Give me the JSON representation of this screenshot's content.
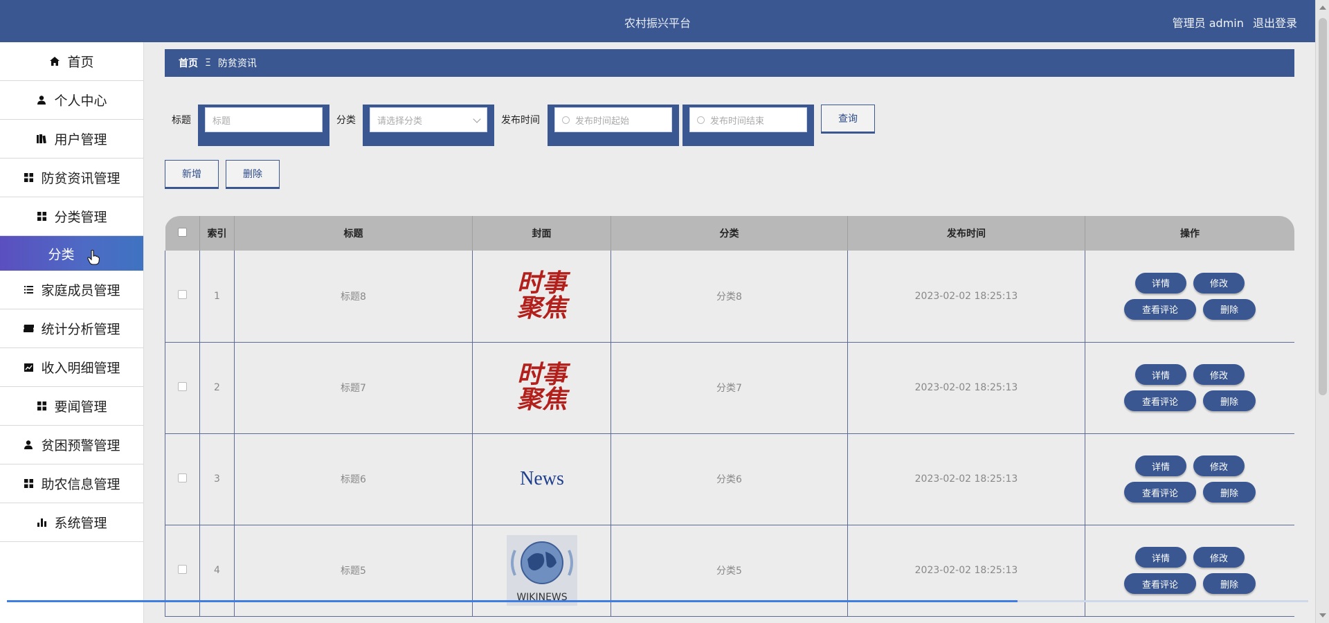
{
  "header": {
    "title": "农村振兴平台",
    "user": "管理员 admin",
    "logout": "退出登录"
  },
  "sidebar": {
    "items": [
      {
        "label": "首页",
        "icon": "home-icon"
      },
      {
        "label": "个人中心",
        "icon": "user-icon"
      },
      {
        "label": "用户管理",
        "icon": "book-icon"
      },
      {
        "label": "防贫资讯管理",
        "icon": "grid-icon"
      },
      {
        "label": "分类管理",
        "icon": "grid-icon"
      },
      {
        "label": "分类",
        "icon": "",
        "active": true
      },
      {
        "label": "家庭成员管理",
        "icon": "list-icon"
      },
      {
        "label": "统计分析管理",
        "icon": "ticket-icon"
      },
      {
        "label": "收入明细管理",
        "icon": "chart-icon"
      },
      {
        "label": "要闻管理",
        "icon": "grid-icon"
      },
      {
        "label": "贫困预警管理",
        "icon": "user-icon"
      },
      {
        "label": "助农信息管理",
        "icon": "grid-icon"
      },
      {
        "label": "系统管理",
        "icon": "bar-chart-icon"
      }
    ]
  },
  "breadcrumb": {
    "home": "首页",
    "separator": "Ξ",
    "current": "防贫资讯"
  },
  "filter": {
    "title_label": "标题",
    "title_placeholder": "标题",
    "category_label": "分类",
    "category_placeholder": "请选择分类",
    "time_label": "发布时间",
    "time_start_placeholder": "发布时间起始",
    "time_end_placeholder": "发布时间结束",
    "search_button": "查询"
  },
  "actions": {
    "add": "新增",
    "delete": "删除"
  },
  "table": {
    "headers": [
      "索引",
      "标题",
      "封面",
      "分类",
      "发布时间",
      "操作"
    ],
    "rows": [
      {
        "index": "1",
        "title": "标题8",
        "cover": "时事聚焦",
        "category": "分类8",
        "time": "2023-02-02 18:25:13"
      },
      {
        "index": "2",
        "title": "标题7",
        "cover": "时事聚焦",
        "category": "分类7",
        "time": "2023-02-02 18:25:13"
      },
      {
        "index": "3",
        "title": "标题6",
        "cover": "News",
        "category": "分类6",
        "time": "2023-02-02 18:25:13"
      },
      {
        "index": "4",
        "title": "标题5",
        "cover": "WIKINEWS",
        "category": "分类5",
        "time": "2023-02-02 18:25:13"
      }
    ],
    "ops": {
      "detail": "详情",
      "edit": "修改",
      "comments": "查看评论",
      "delete": "删除"
    }
  },
  "colors": {
    "primary": "#3a5791",
    "sidebar_active": "#5b4fbf",
    "cover_red": "#b3201c"
  }
}
